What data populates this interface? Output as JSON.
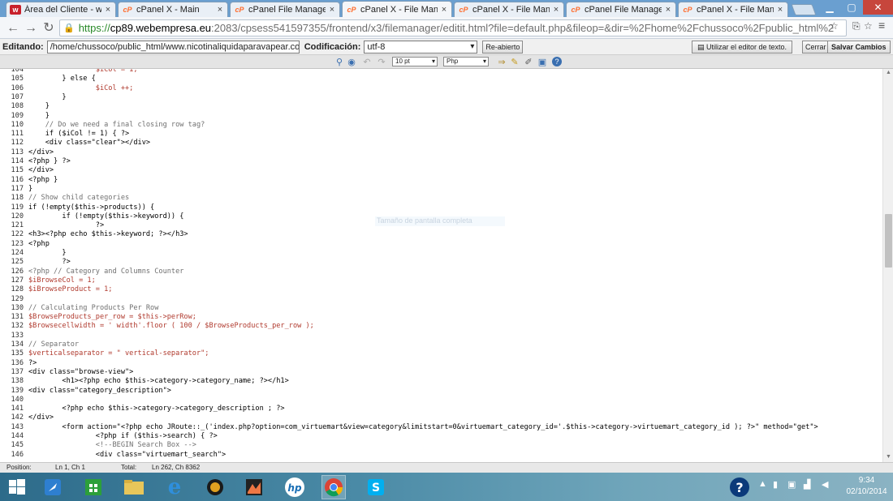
{
  "browser": {
    "tabs": [
      {
        "title": "Área del Cliente - web",
        "favicon": "wc"
      },
      {
        "title": "cPanel X - Main",
        "favicon": "cp"
      },
      {
        "title": "cPanel File Manager v",
        "favicon": "cp"
      },
      {
        "title": "cPanel X - File Manag",
        "favicon": "cp",
        "active": true
      },
      {
        "title": "cPanel X - File Manag",
        "favicon": "cp"
      },
      {
        "title": "cPanel File Manager v",
        "favicon": "cp"
      },
      {
        "title": "cPanel X - File Manag",
        "favicon": "cp"
      }
    ],
    "close_glyph": "×",
    "url_scheme": "https://",
    "url_host": "cp89.webempresa.eu",
    "url_rest": ":2083/cpsess541597355/frontend/x3/filemanager/editit.html?file=default.php&fileop=&dir=%2Fhome%2Fchussoco%2Fpublic_html%2"
  },
  "editor_bar": {
    "editing_label": "Editando:",
    "path": "/home/chussoco/public_html/www.nicotinaliquidaparavapear.com",
    "encoding_label": "Codificación:",
    "encoding": "utf-8",
    "reopen": "Re-abierto",
    "use_text_editor": "Utilizar el editor de texto.",
    "close": "Cerrar",
    "save": "Salvar Cambios"
  },
  "ace_toolbar": {
    "font_size": "10 pt",
    "mode": "Php"
  },
  "ghost_tooltip": "Tamaño de pantalla completa",
  "code": {
    "lines": [
      {
        "n": 104,
        "t": "                $iCol = 1;"
      },
      {
        "n": 105,
        "t": "        } else {"
      },
      {
        "n": 106,
        "t": "                $iCol ++;"
      },
      {
        "n": 107,
        "t": "        }"
      },
      {
        "n": 108,
        "t": "    }"
      },
      {
        "n": 109,
        "t": "    }"
      },
      {
        "n": 110,
        "t": "    // Do we need a final closing row tag?"
      },
      {
        "n": 111,
        "t": "    if ($iCol != 1) { ?>"
      },
      {
        "n": 112,
        "t": "    <div class=\"clear\"></div>"
      },
      {
        "n": 113,
        "t": "</div>"
      },
      {
        "n": 114,
        "t": "<?php } ?>"
      },
      {
        "n": 115,
        "t": "</div>"
      },
      {
        "n": 116,
        "t": "<?php }"
      },
      {
        "n": 117,
        "t": "}"
      },
      {
        "n": 118,
        "t": "// Show child categories"
      },
      {
        "n": 119,
        "t": "if (!empty($this->products)) {"
      },
      {
        "n": 120,
        "t": "        if (!empty($this->keyword)) {"
      },
      {
        "n": 121,
        "t": "                ?>"
      },
      {
        "n": 122,
        "t": "<h3><?php echo $this->keyword; ?></h3>"
      },
      {
        "n": 123,
        "t": "<?php"
      },
      {
        "n": 124,
        "t": "        }"
      },
      {
        "n": 125,
        "t": "        ?>"
      },
      {
        "n": 126,
        "t": "<?php // Category and Columns Counter"
      },
      {
        "n": 127,
        "t": "$iBrowseCol = 1;"
      },
      {
        "n": 128,
        "t": "$iBrowseProduct = 1;"
      },
      {
        "n": 129,
        "t": ""
      },
      {
        "n": 130,
        "t": "// Calculating Products Per Row"
      },
      {
        "n": 131,
        "t": "$BrowseProducts_per_row = $this->perRow;"
      },
      {
        "n": 132,
        "t": "$Browsecellwidth = ' width'.floor ( 100 / $BrowseProducts_per_row );"
      },
      {
        "n": 133,
        "t": ""
      },
      {
        "n": 134,
        "t": "// Separator"
      },
      {
        "n": 135,
        "t": "$verticalseparator = \" vertical-separator\";"
      },
      {
        "n": 136,
        "t": "?>"
      },
      {
        "n": 137,
        "t": "<div class=\"browse-view\">"
      },
      {
        "n": 138,
        "t": "        <h1><?php echo $this->category->category_name; ?></h1>"
      },
      {
        "n": 139,
        "t": "<div class=\"category_description\">"
      },
      {
        "n": 140,
        "t": ""
      },
      {
        "n": 141,
        "t": "        <?php echo $this->category->category_description ; ?>"
      },
      {
        "n": 142,
        "t": "</div>"
      },
      {
        "n": 143,
        "t": "        <form action=\"<?php echo JRoute::_('index.php?option=com_virtuemart&view=category&limitstart=0&virtuemart_category_id='.$this->category->virtuemart_category_id ); ?>\" method=\"get\">"
      },
      {
        "n": 144,
        "t": "                <?php if ($this->search) { ?>"
      },
      {
        "n": 145,
        "t": "                <!--BEGIN Search Box -->"
      },
      {
        "n": 146,
        "t": "                <div class=\"virtuemart_search\">"
      }
    ]
  },
  "status": {
    "position_label": "Position:",
    "position_value": "Ln 1, Ch 1",
    "total_label": "Total:",
    "total_value": "Ln 262, Ch 8362"
  },
  "clock": {
    "time": "9:34",
    "date": "02/10/2014"
  }
}
